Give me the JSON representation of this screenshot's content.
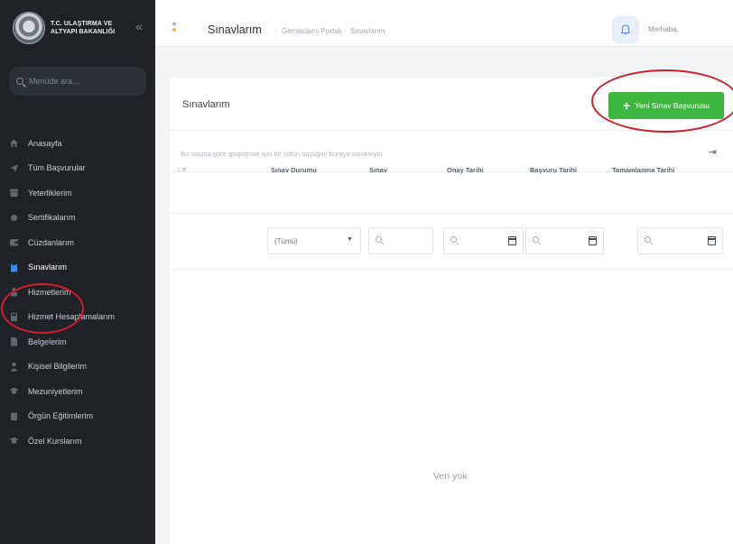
{
  "brand": {
    "line1": "T.C. ULAŞTIRMA VE",
    "line2": "ALTYAPI BAKANLIĞI",
    "collapse_icon": "double-chevron-left-icon"
  },
  "sidebar": {
    "search_placeholder": "Menüde ara...",
    "items": [
      {
        "label": "Anasayfa",
        "icon": "home-icon"
      },
      {
        "label": "Tüm Başvurular",
        "icon": "send-icon"
      },
      {
        "label": "Yeterliklerim",
        "icon": "archive-icon"
      },
      {
        "label": "Sertifikalarım",
        "icon": "dot-icon"
      },
      {
        "label": "Cüzdanlarım",
        "icon": "wallet-icon"
      },
      {
        "label": "Sınavlarım",
        "icon": "clipboard-icon",
        "active": true
      },
      {
        "label": "Hizmetlerim",
        "icon": "person-icon"
      },
      {
        "label": "Hizmet Hesaplamalarım",
        "icon": "calculator-icon"
      },
      {
        "label": "Belgelerim",
        "icon": "document-icon"
      },
      {
        "label": "Kişisel Bilgilerim",
        "icon": "user-icon"
      },
      {
        "label": "Mezuniyetlerim",
        "icon": "graduation-cap-icon"
      },
      {
        "label": "Örgün Eğitimlerim",
        "icon": "book-icon"
      },
      {
        "label": "Özel Kurslarım",
        "icon": "graduation-cap-icon"
      }
    ]
  },
  "topbar": {
    "title": "Sınavlarım",
    "breadcrumb": [
      "Gemiadamı Portalı",
      "Sınavlarım"
    ],
    "greeting": "Merhaba,"
  },
  "page": {
    "card_title": "Sınavlarım",
    "new_button_label": "Yeni Sınav Başvurusu",
    "group_hint": "Bu sütuna göre gruplamak için bir sütun başlığını buraya sürükleyin",
    "columns": {
      "hash": "#",
      "status": "Sınav Durumu",
      "exam": "Sınav",
      "approval_date": "Onay Tarihi",
      "application_date": "Başvuru Tarihi",
      "completion_date": "Tamamlanma Tarihi"
    },
    "status_filter_value": "(Tümü)",
    "empty_text": "Veri yok"
  },
  "colors": {
    "sidebar_bg": "#1f2328",
    "active": "#3b8be6",
    "primary_button": "#3fb63f",
    "annotation_red": "#cf1e2e"
  }
}
